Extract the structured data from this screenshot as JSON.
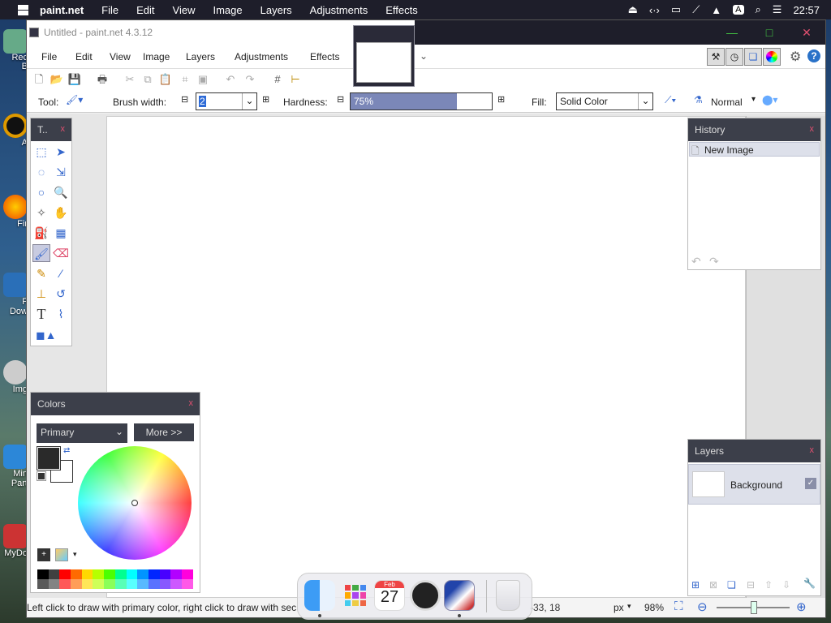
{
  "os": {
    "app_name": "paint.net",
    "menu": [
      "File",
      "Edit",
      "View",
      "Image",
      "Layers",
      "Adjustments",
      "Effects"
    ],
    "status_letter": "A",
    "clock": "22:57"
  },
  "desktop": {
    "icons": [
      "Rec\nB",
      "A",
      "Fir",
      "F\nDow",
      "Img",
      "Min\nPart",
      "MyDo"
    ]
  },
  "window": {
    "title": "Untitled - paint.net 4.3.12",
    "menu": [
      "File",
      "Edit",
      "View",
      "Image",
      "Layers",
      "Adjustments",
      "Effects"
    ],
    "tool_label": "Tool:",
    "brush_width_label": "Brush width:",
    "brush_width_value": "2",
    "hardness_label": "Hardness:",
    "hardness_value": "75%",
    "hardness_fraction": 0.75,
    "fill_label": "Fill:",
    "fill_value": "Solid Color",
    "blend_mode": "Normal"
  },
  "tools_panel": {
    "title": "T..",
    "close": "x"
  },
  "history_panel": {
    "title": "History",
    "close": "x",
    "items": [
      "New Image"
    ]
  },
  "layers_panel": {
    "title": "Layers",
    "close": "x",
    "layers": [
      "Background"
    ]
  },
  "colors_panel": {
    "title": "Colors",
    "close": "x",
    "mode": "Primary",
    "more_button": "More >>"
  },
  "status": {
    "hint": "Left click to draw with primary color, right click to draw with sec",
    "coords": "-33, 18",
    "unit": "px",
    "zoom": "98%"
  },
  "dock": {
    "calendar_month": "Feb",
    "calendar_day": "27"
  },
  "colors": {
    "accent": "#3c3f4a",
    "palette": [
      "#ff0000",
      "#ff6a00",
      "#ffd800",
      "#b6ff00",
      "#4cff00",
      "#00ff90",
      "#00ffff",
      "#0094ff",
      "#0026ff",
      "#4800ff",
      "#b200ff",
      "#ff00dc"
    ]
  }
}
